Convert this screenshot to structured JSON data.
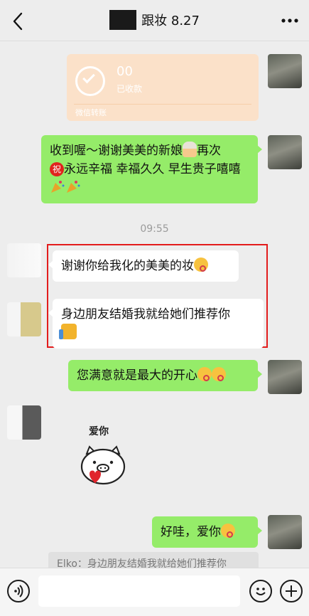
{
  "header": {
    "title": "跟妆 8.27",
    "back_icon": "chevron-left-icon",
    "more_icon": "more-dots-icon"
  },
  "transfer": {
    "amount": "00",
    "status": "已收款",
    "label": "微信转账",
    "icon": "check-circle-icon"
  },
  "messages": [
    {
      "side": "right",
      "parts": [
        "收到喔～谢谢美美的新娘",
        "再次",
        "祝",
        "永远辛福  幸福久久  早生贵子嘻嘻"
      ]
    },
    {
      "side": "left",
      "text": "谢谢你给我化的美美的妆"
    },
    {
      "side": "left",
      "text": "身边朋友结婚我就给她们推荐你"
    },
    {
      "side": "right",
      "text": "您满意就是最大的开心"
    },
    {
      "side": "left",
      "sticker_text": "爱你"
    },
    {
      "side": "right",
      "text": "好哇，爱你"
    }
  ],
  "time_divider": "09:55",
  "quote": "Elko：身边朋友结婚我就给她们推荐你",
  "bottom": {
    "input_placeholder": "",
    "voice_icon": "voice-icon",
    "emoji_icon": "emoji-icon",
    "plus_icon": "plus-icon"
  },
  "colors": {
    "background": "#ededed",
    "bubble_me": "#95ec69",
    "bubble_other": "#ffffff",
    "highlight": "#e31c1c",
    "transfer_faded": "#fbe1c9"
  }
}
